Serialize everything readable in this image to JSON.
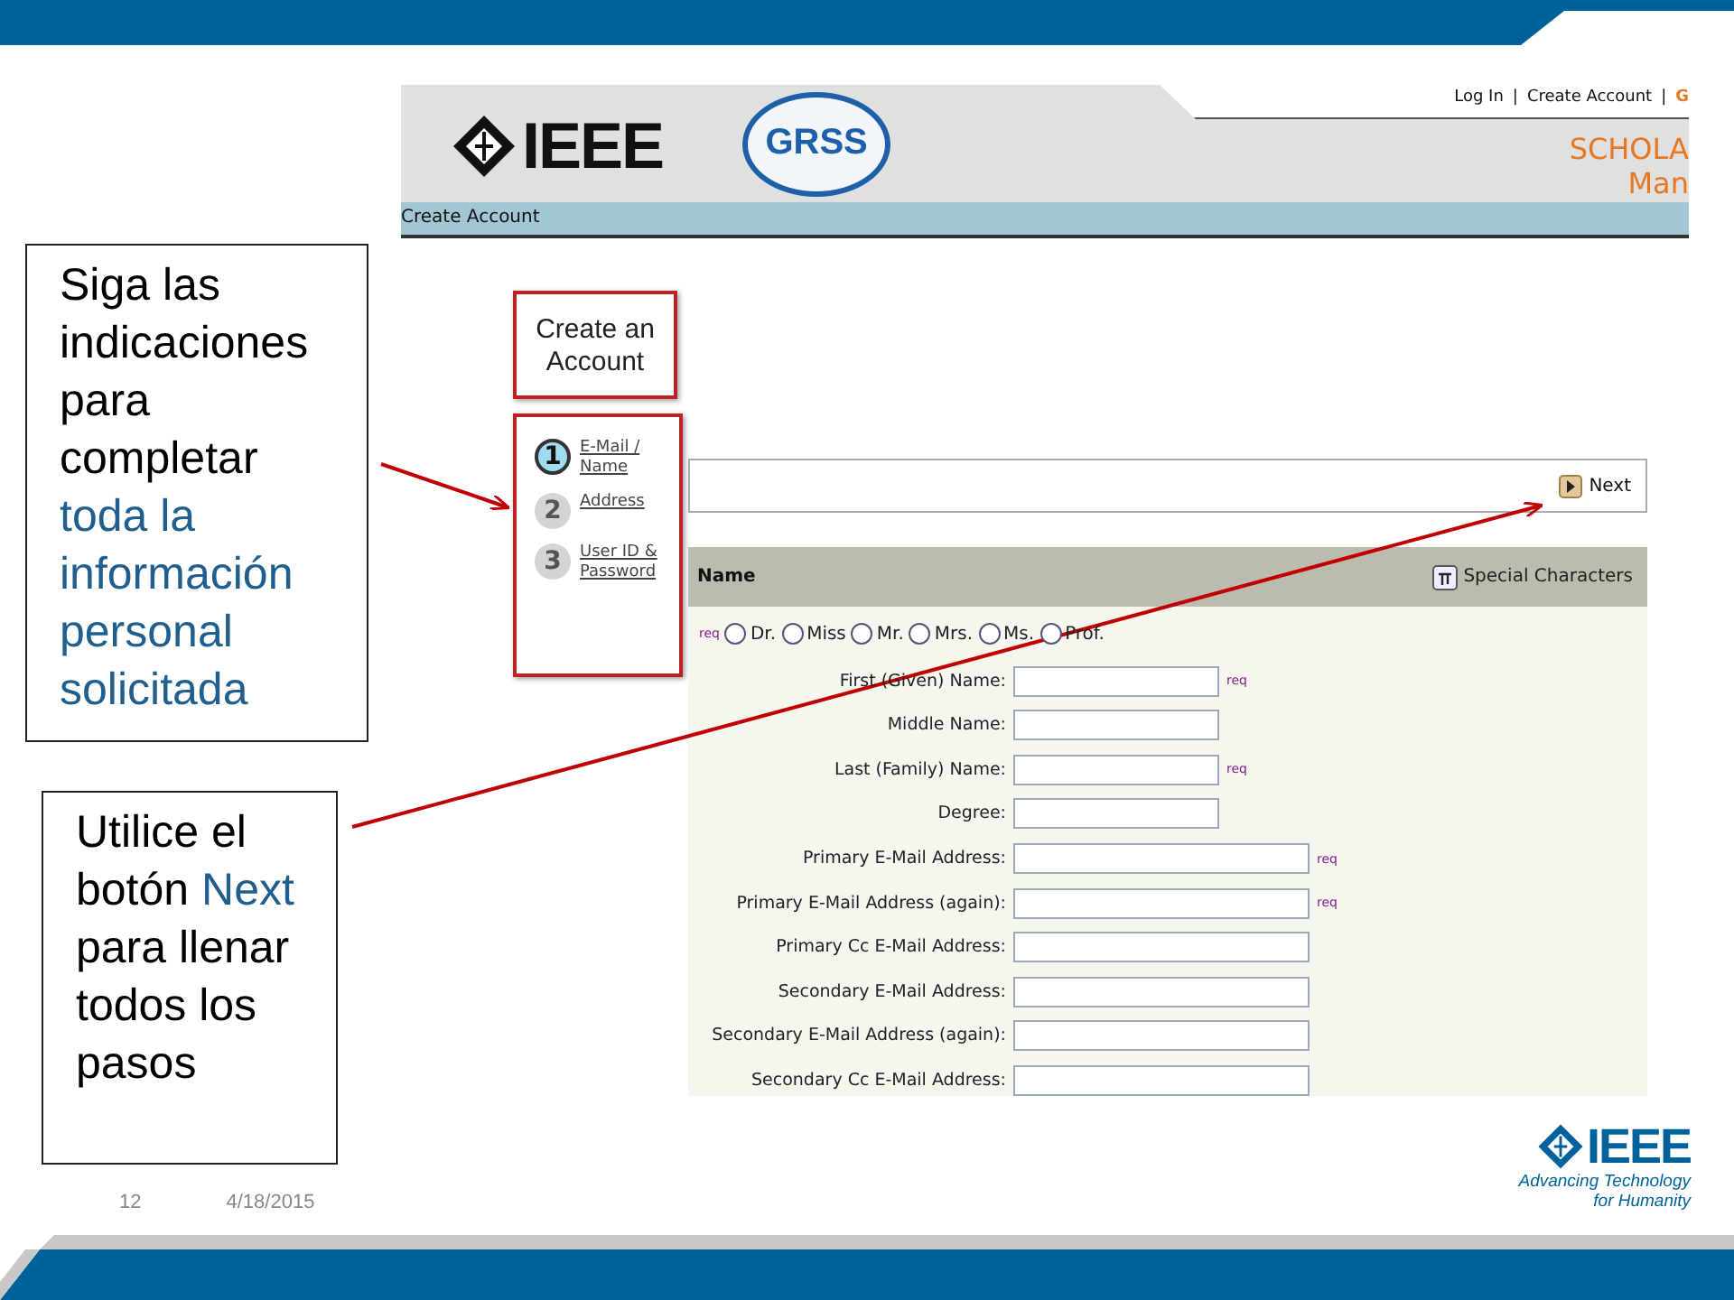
{
  "slide": {
    "page_number": "12",
    "date": "4/18/2015",
    "footer_logo": {
      "wordmark": "IEEE",
      "tagline": [
        "Advancing Technology",
        "for Humanity"
      ]
    }
  },
  "callouts": [
    {
      "segments": [
        {
          "text": "Siga las indicaciones para completar ",
          "highlight": false
        },
        {
          "text": "toda la información personal solicitada",
          "highlight": true
        }
      ]
    },
    {
      "segments": [
        {
          "text": "Utilice el botón ",
          "highlight": false
        },
        {
          "text": "Next",
          "highlight": true
        },
        {
          "text": " para llenar todos los pasos",
          "highlight": false
        }
      ]
    }
  ],
  "site": {
    "header_items": [
      {
        "kind": "link",
        "text": "Log In"
      },
      {
        "kind": "separator",
        "text": "|"
      },
      {
        "kind": "link",
        "text": "Create Account"
      },
      {
        "kind": "separator",
        "text": "|"
      },
      {
        "kind": "link_active",
        "text": "G"
      }
    ],
    "logo_text": "IEEE",
    "society_logo_text": "GRSS",
    "title_lines": [
      "SCHOLA",
      "Man"
    ],
    "breadcrumb": "Create Account"
  },
  "page_title": "Create an Account",
  "steps": [
    {
      "number": "1",
      "label": "E-Mail / Name",
      "selected": true
    },
    {
      "number": "2",
      "label": "Address",
      "selected": false
    },
    {
      "number": "3",
      "label": "User ID & Password",
      "selected": false
    }
  ],
  "next_button": "Next",
  "panel": {
    "title": "Name",
    "special_button": "Special Characters",
    "salutation_note": "req",
    "salutations": [
      {
        "label": "Dr.",
        "selected": false
      },
      {
        "label": "Miss",
        "selected": false
      },
      {
        "label": "Mr.",
        "selected": false
      },
      {
        "label": "Mrs.",
        "selected": false
      },
      {
        "label": "Ms.",
        "selected": false
      },
      {
        "label": "Prof.",
        "selected": false
      }
    ]
  },
  "fields": [
    {
      "label": "First (Given) Name:",
      "kind": "short",
      "note": "req"
    },
    {
      "label": "Middle Name:",
      "kind": "short"
    },
    {
      "label": "Last (Family) Name:",
      "kind": "short",
      "note": "req"
    },
    {
      "label": "Degree:",
      "kind": "short"
    },
    {
      "label": "Primary E-Mail Address:",
      "kind": "long",
      "note": "req"
    },
    {
      "label": "Primary E-Mail Address (again):",
      "kind": "long",
      "note": "req"
    },
    {
      "label": "Primary Cc E-Mail Address:",
      "kind": "long"
    },
    {
      "label": "Secondary E-Mail Address:",
      "kind": "long"
    },
    {
      "label": "Secondary E-Mail Address (again):",
      "kind": "long"
    },
    {
      "label": "Secondary Cc E-Mail Address:",
      "kind": "long"
    }
  ]
}
